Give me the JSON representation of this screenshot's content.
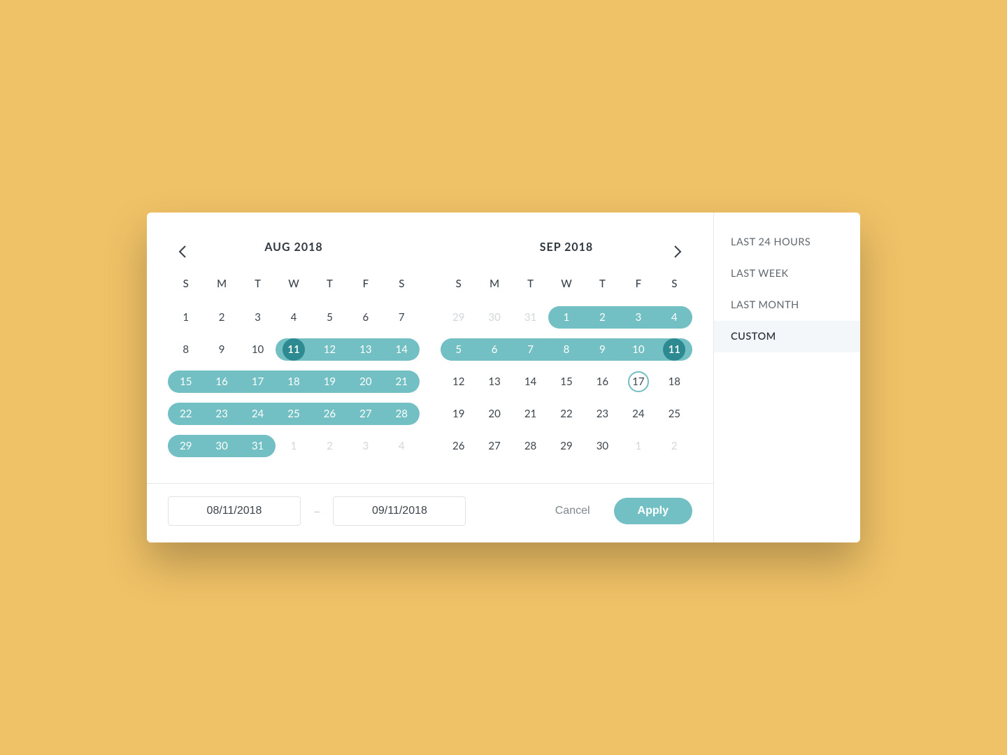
{
  "colors": {
    "accent": "#72bfc4",
    "accentDark": "#2c8a90",
    "bg": "#f0c267"
  },
  "sidebar": {
    "presets": [
      {
        "label": "LAST 24 HOURS",
        "active": false
      },
      {
        "label": "LAST WEEK",
        "active": false
      },
      {
        "label": "LAST MONTH",
        "active": false
      },
      {
        "label": "CUSTOM",
        "active": true
      }
    ]
  },
  "footer": {
    "start": "08/11/2018",
    "end": "09/11/2018",
    "dash": "–",
    "cancel": "Cancel",
    "apply": "Apply"
  },
  "dow": [
    "S",
    "M",
    "T",
    "W",
    "T",
    "F",
    "S"
  ],
  "calendars": {
    "left": {
      "title": "AUG 2018",
      "weeks": [
        [
          {
            "n": "1"
          },
          {
            "n": "2"
          },
          {
            "n": "3"
          },
          {
            "n": "4"
          },
          {
            "n": "5"
          },
          {
            "n": "6"
          },
          {
            "n": "7"
          }
        ],
        [
          {
            "n": "8"
          },
          {
            "n": "9"
          },
          {
            "n": "10"
          },
          {
            "n": "11",
            "range": "start",
            "endpoint": true
          },
          {
            "n": "12",
            "range": "mid"
          },
          {
            "n": "13",
            "range": "mid"
          },
          {
            "n": "14",
            "range": "end"
          }
        ],
        [
          {
            "n": "15",
            "range": "start"
          },
          {
            "n": "16",
            "range": "mid"
          },
          {
            "n": "17",
            "range": "mid"
          },
          {
            "n": "18",
            "range": "mid"
          },
          {
            "n": "19",
            "range": "mid"
          },
          {
            "n": "20",
            "range": "mid"
          },
          {
            "n": "21",
            "range": "end"
          }
        ],
        [
          {
            "n": "22",
            "range": "start"
          },
          {
            "n": "23",
            "range": "mid"
          },
          {
            "n": "24",
            "range": "mid"
          },
          {
            "n": "25",
            "range": "mid"
          },
          {
            "n": "26",
            "range": "mid"
          },
          {
            "n": "27",
            "range": "mid"
          },
          {
            "n": "28",
            "range": "end"
          }
        ],
        [
          {
            "n": "29",
            "range": "start"
          },
          {
            "n": "30",
            "range": "mid"
          },
          {
            "n": "31",
            "range": "end"
          },
          {
            "n": "1",
            "muted": true
          },
          {
            "n": "2",
            "muted": true
          },
          {
            "n": "3",
            "muted": true
          },
          {
            "n": "4",
            "muted": true
          }
        ]
      ]
    },
    "right": {
      "title": "SEP 2018",
      "weeks": [
        [
          {
            "n": "29",
            "muted": true
          },
          {
            "n": "30",
            "muted": true
          },
          {
            "n": "31",
            "muted": true
          },
          {
            "n": "1",
            "range": "start"
          },
          {
            "n": "2",
            "range": "mid"
          },
          {
            "n": "3",
            "range": "mid"
          },
          {
            "n": "4",
            "range": "end"
          }
        ],
        [
          {
            "n": "5",
            "range": "start"
          },
          {
            "n": "6",
            "range": "mid"
          },
          {
            "n": "7",
            "range": "mid"
          },
          {
            "n": "8",
            "range": "mid"
          },
          {
            "n": "9",
            "range": "mid"
          },
          {
            "n": "10",
            "range": "mid"
          },
          {
            "n": "11",
            "range": "end",
            "endpoint": true
          }
        ],
        [
          {
            "n": "12"
          },
          {
            "n": "13"
          },
          {
            "n": "14"
          },
          {
            "n": "15"
          },
          {
            "n": "16"
          },
          {
            "n": "17",
            "today": true
          },
          {
            "n": "18"
          }
        ],
        [
          {
            "n": "19"
          },
          {
            "n": "20"
          },
          {
            "n": "21"
          },
          {
            "n": "22"
          },
          {
            "n": "23"
          },
          {
            "n": "24"
          },
          {
            "n": "25"
          }
        ],
        [
          {
            "n": "26"
          },
          {
            "n": "27"
          },
          {
            "n": "28"
          },
          {
            "n": "29"
          },
          {
            "n": "30"
          },
          {
            "n": "1",
            "muted": true
          },
          {
            "n": "2",
            "muted": true
          }
        ]
      ]
    }
  }
}
